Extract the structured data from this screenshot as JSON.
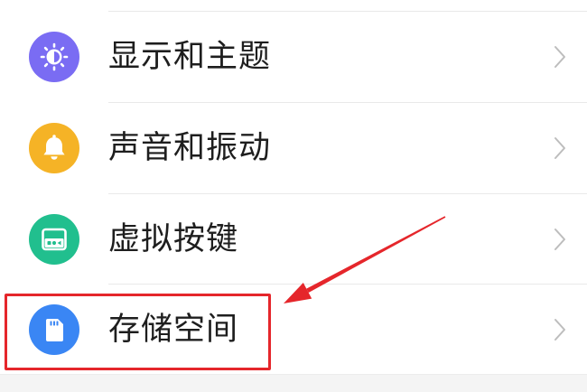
{
  "settings": {
    "items": [
      {
        "label": "显示和主题",
        "icon": "brightness-icon",
        "icon_color": "#7A6CF3"
      },
      {
        "label": "声音和振动",
        "icon": "bell-icon",
        "icon_color": "#F5B326"
      },
      {
        "label": "虚拟按键",
        "icon": "virtual-keys-icon",
        "icon_color": "#21BF8E"
      },
      {
        "label": "存储空间",
        "icon": "sd-card-icon",
        "icon_color": "#3A86F4"
      }
    ]
  },
  "annotation": {
    "color": "#E5262B"
  },
  "theme": {
    "text_color": "#1E1E1E",
    "divider_color": "#E9E9E9",
    "chevron_color": "#BDBDBD",
    "icon_glyph_color": "#FFFFFF"
  }
}
